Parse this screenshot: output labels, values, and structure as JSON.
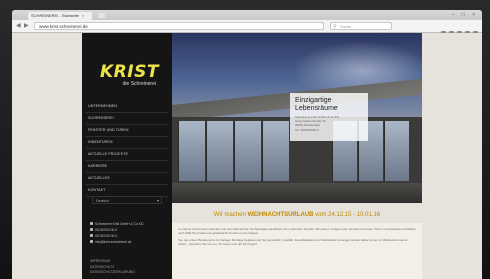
{
  "browser": {
    "tab_title": "SCHREINEREI - Startseite",
    "tab_close": "×",
    "window_controls": "– □ ×",
    "url": "www.krist-schreinerei.de",
    "search_placeholder": "Suche",
    "nav_back": "◀",
    "nav_forward": "▶"
  },
  "sidebar": {
    "logo_text": "KRIST",
    "logo_sub": "die Schreinerei",
    "menu": [
      "Unternehmen",
      "Schreinerei",
      "Fenster und Türen",
      "Innentüren",
      "Aktuelle Projekte",
      "Karriere",
      "Aktuelles",
      "Kontakt"
    ],
    "language": "Deutsch",
    "contact": [
      "Schreinerei Krist GmbH & Co.KG",
      "08 00/000 00-0",
      "08 00/000 00-0",
      "info@krist-schreinerei.de"
    ],
    "footer_links": [
      "Impressum",
      "Datenschutz",
      "Datenschutzerklärung"
    ]
  },
  "hero": {
    "title": "Einzigartige Lebensräume",
    "lines": [
      "Schreinerei Krist GmbH & Co.KG",
      "Hans-Sachs-Straße 00",
      "00000 Musterstadt",
      "Tel. 0800/00000-0"
    ]
  },
  "banner": {
    "prefix": "Wir machen ",
    "emphasis": "WEIHNACHTSURLAUB",
    "suffix": " vom 24.12.15 - 10.01.16"
  },
  "content": {
    "paragraphs": [
      "In unserer Schreinerei verbinden wir seit Jahrzehnten hochwertiges Handwerk mit modernster Technik. Wir planen, fertigen und montieren Fenster, Türen, Innenausbau und Möbel nach Maß für private und gewerbliche Kunden in der Region.",
      "Von der ersten Beratung bis zur fertigen Montage begleiten wir Sie persönlich. Qualität, Zuverlässigkeit und individuelle Lösungen stehen dabei immer im Mittelpunkt unserer Arbeit – sprechen Sie uns an, wir freuen uns auf Ihr Projekt."
    ]
  }
}
